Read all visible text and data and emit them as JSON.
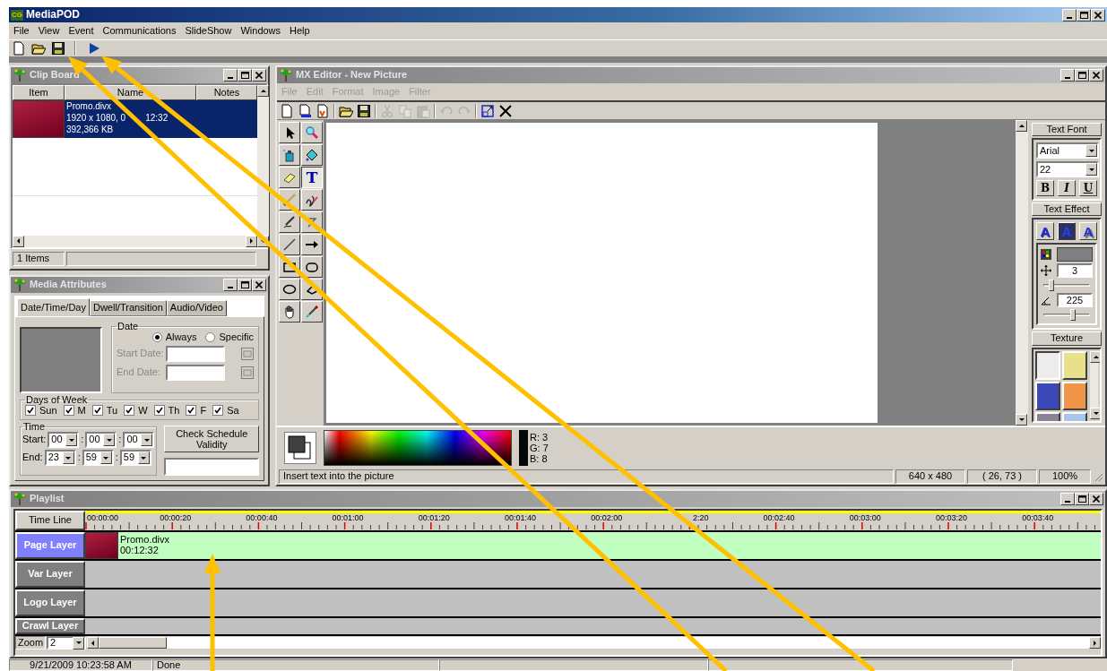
{
  "window": {
    "logo_text": "CG",
    "title": "MediaPOD"
  },
  "menu": [
    "File",
    "View",
    "Event",
    "Communications",
    "SlideShow",
    "Windows",
    "Help"
  ],
  "toolbar": [
    {
      "kind": "new"
    },
    {
      "kind": "open"
    },
    {
      "kind": "save"
    },
    {
      "kind": "sep"
    },
    {
      "kind": "play"
    }
  ],
  "clip_board": {
    "title": "Clip Board",
    "columns": [
      "Item",
      "Name",
      "Notes"
    ],
    "rows": [
      {
        "name": "Promo.divx",
        "details": [
          "1920 x 1080, 0",
          "12:32"
        ],
        "size": "392,366 KB",
        "selected": true
      }
    ],
    "status": "1 Items"
  },
  "media_attributes": {
    "title": "Media Attributes",
    "tabs": [
      {
        "label": "Date/Time/Day",
        "selected": true
      },
      {
        "label": "Dwell/Transition",
        "selected": false
      },
      {
        "label": "Audio/Video",
        "selected": false
      }
    ],
    "date": {
      "legend": "Date",
      "options": [
        {
          "label": "Always",
          "selected": true
        },
        {
          "label": "Specific",
          "selected": false
        }
      ],
      "fields": [
        {
          "label": "Start Date:"
        },
        {
          "label": "End Date:"
        }
      ],
      "disabled": true
    },
    "days": {
      "legend": "Days of Week",
      "items": [
        {
          "label": "Sun",
          "checked": true
        },
        {
          "label": "M",
          "checked": true
        },
        {
          "label": "Tu",
          "checked": true
        },
        {
          "label": "W",
          "checked": true
        },
        {
          "label": "Th",
          "checked": true
        },
        {
          "label": "F",
          "checked": true
        },
        {
          "label": "Sa",
          "checked": true
        }
      ]
    },
    "time": {
      "legend": "Time",
      "separator": ":",
      "rows": [
        {
          "label": "Start:",
          "values": [
            "00",
            "00",
            "00"
          ]
        },
        {
          "label": "End:",
          "values": [
            "23",
            "59",
            "59"
          ]
        }
      ]
    },
    "check_button": "Check Schedule Validity"
  },
  "mx_editor": {
    "title": "MX Editor - New Picture",
    "menu": [
      {
        "label": "File",
        "disabled": true
      },
      {
        "label": "Edit",
        "disabled": true
      },
      {
        "label": "Format",
        "disabled": true
      },
      {
        "label": "Image",
        "disabled": true
      },
      {
        "label": "Filter",
        "disabled": true
      }
    ],
    "toolbar": [
      {
        "kind": "new",
        "disabled": false
      },
      {
        "kind": "newlayer",
        "disabled": false
      },
      {
        "kind": "template",
        "disabled": false
      },
      {
        "kind": "sep"
      },
      {
        "kind": "open",
        "disabled": false
      },
      {
        "kind": "save",
        "disabled": false
      },
      {
        "kind": "sep"
      },
      {
        "kind": "cut",
        "disabled": true
      },
      {
        "kind": "copy",
        "disabled": true
      },
      {
        "kind": "paste",
        "disabled": true
      },
      {
        "kind": "sep"
      },
      {
        "kind": "undo",
        "disabled": true
      },
      {
        "kind": "redo",
        "disabled": true
      },
      {
        "kind": "sep"
      },
      {
        "kind": "resize",
        "disabled": false
      },
      {
        "kind": "close",
        "disabled": false
      }
    ],
    "tools": [
      {
        "kind": "pointer",
        "selected": false
      },
      {
        "kind": "zoom",
        "selected": false
      },
      {
        "kind": "spray",
        "selected": false
      },
      {
        "kind": "fill",
        "selected": false
      },
      {
        "kind": "eraser",
        "selected": false
      },
      {
        "kind": "text",
        "label": "T",
        "selected": true
      },
      {
        "kind": "brush",
        "selected": false
      },
      {
        "kind": "pencil",
        "selected": false
      },
      {
        "kind": "pen",
        "selected": false
      },
      {
        "kind": "curve",
        "selected": false
      },
      {
        "kind": "line",
        "selected": false
      },
      {
        "kind": "arrow",
        "selected": false
      },
      {
        "kind": "rect",
        "selected": false
      },
      {
        "kind": "roundrect",
        "selected": false
      },
      {
        "kind": "ellipse",
        "selected": false
      },
      {
        "kind": "polygon",
        "selected": false
      },
      {
        "kind": "hand",
        "selected": false
      },
      {
        "kind": "eyedropper",
        "selected": false
      }
    ],
    "text_font": {
      "title": "Text Font",
      "font": "Arial",
      "size": "22",
      "styles": [
        {
          "label": "B",
          "kind": "bold"
        },
        {
          "label": "I",
          "kind": "italic"
        },
        {
          "label": "U",
          "kind": "underline"
        }
      ]
    },
    "text_effect": {
      "title": "Text Effect",
      "effects": [
        {
          "label": "A",
          "kind": "outline"
        },
        {
          "label": "A",
          "kind": "solid"
        },
        {
          "label": "A",
          "kind": "shadow"
        }
      ],
      "distance": "3",
      "distance_slider": {
        "level": 0.2
      },
      "angle": "225",
      "angle_slider": {
        "level": 0.62
      }
    },
    "texture": {
      "title": "Texture",
      "swatches": [
        {
          "color": "#ececec",
          "selected": true
        },
        {
          "color": "#e8e08a",
          "selected": false
        },
        {
          "color": "#3a48b8",
          "selected": false
        },
        {
          "color": "#f0964a",
          "selected": false
        },
        {
          "color": "#8a8398",
          "selected": false
        },
        {
          "color": "#a8c4e8",
          "selected": false
        }
      ]
    },
    "color": {
      "rgb": [
        "R: 3",
        "G: 7",
        "B: 8"
      ]
    },
    "status": {
      "message": "Insert text into the picture",
      "size": "640 x 480",
      "position": "( 26, 73 )",
      "zoom": "100%"
    }
  },
  "playlist": {
    "title": "Playlist",
    "timeline_label": "Time Line",
    "ticks": [
      "00:00:00",
      "00:00:20",
      "00:00:40",
      "00:01:00",
      "00:01:20",
      "00:01:40",
      "00:02:00",
      "2:20",
      "00:02:40",
      "00:03:00",
      "00:03:20",
      "00:03:40"
    ],
    "layers": [
      {
        "label": "Page Layer",
        "selected": true,
        "clips": [
          {
            "name": "Promo.divx",
            "duration": "00:12:32"
          }
        ]
      },
      {
        "label": "Var Layer",
        "selected": false
      },
      {
        "label": "Logo Layer",
        "selected": false
      },
      {
        "label": "Crawl Layer",
        "selected": false
      }
    ],
    "zoom_label": "Zoom",
    "zoom": "2"
  },
  "status_bar": [
    "9/21/2009 10:23:58 AM",
    "Done"
  ]
}
